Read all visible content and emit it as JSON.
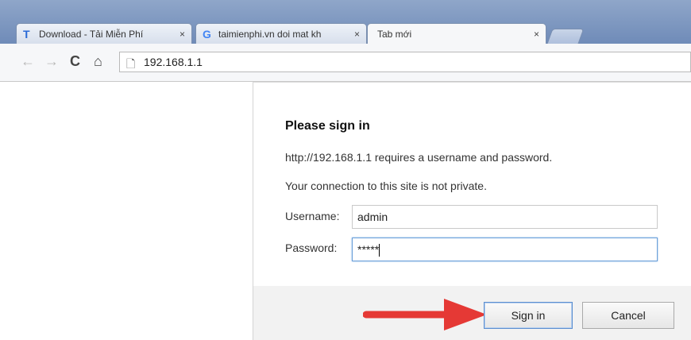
{
  "tabs": [
    {
      "favicon": "T",
      "label": "Download - Tải Miễn Phí",
      "close": "×"
    },
    {
      "favicon": "G",
      "label": "taimienphi.vn doi mat kh",
      "close": "×"
    },
    {
      "favicon": "",
      "label": "Tab mới",
      "close": "×"
    }
  ],
  "toolbar": {
    "back_icon": "←",
    "forward_icon": "→",
    "reload_icon": "C",
    "home_icon": "⌂",
    "page_icon": "🗋",
    "url": "192.168.1.1"
  },
  "dialog": {
    "title": "Please sign in",
    "message1": "http://192.168.1.1 requires a username and password.",
    "message2": "Your connection to this site is not private.",
    "username_label": "Username:",
    "username_value": "admin",
    "password_label": "Password:",
    "password_value": "*****",
    "signin_label": "Sign in",
    "cancel_label": "Cancel"
  },
  "colors": {
    "arrow": "#e53935"
  }
}
